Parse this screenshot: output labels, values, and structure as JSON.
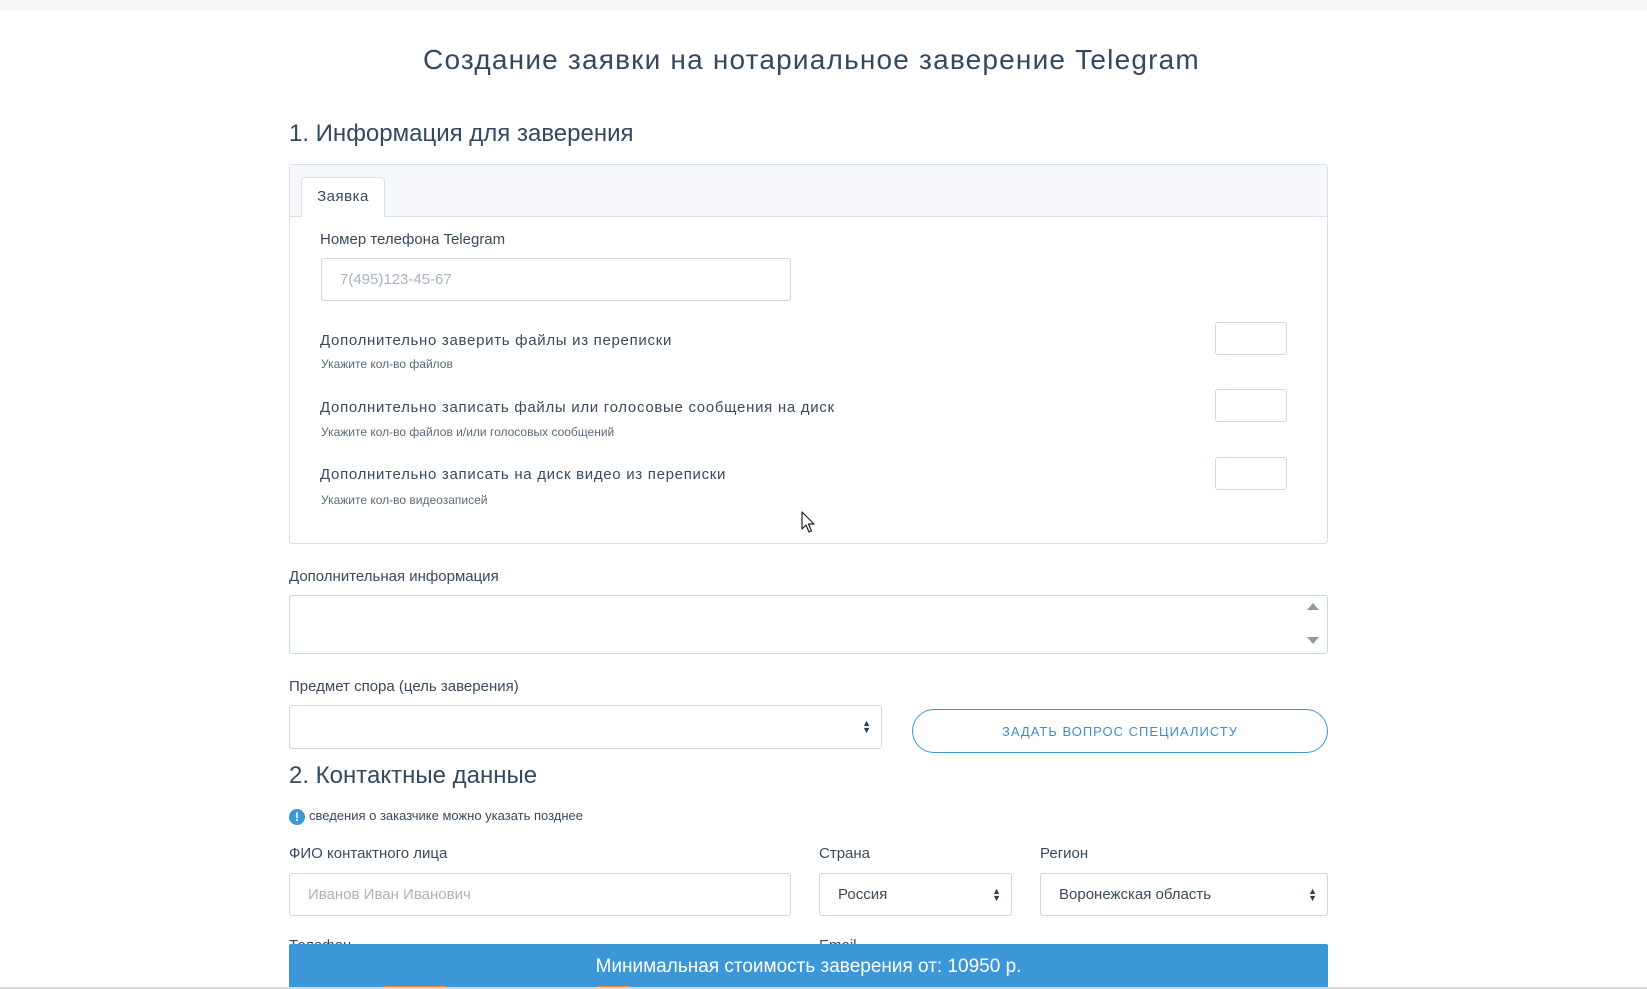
{
  "page": {
    "title": "Создание заявки на нотариальное заверение Telegram"
  },
  "section1": {
    "title": "1. Информация для заверения",
    "tab_label": "Заявка",
    "phone_label": "Номер телефона Telegram",
    "phone_placeholder": "7(495)123-45-67",
    "phone_value": "",
    "options": [
      {
        "label": "Дополнительно заверить файлы из переписки",
        "hint": "Укажите кол-во файлов",
        "value": ""
      },
      {
        "label": "Дополнительно записать файлы или голосовые сообщения на диск",
        "hint": "Укажите кол-во файлов и/или голосовых сообщений",
        "value": ""
      },
      {
        "label": "Дополнительно записать на диск видео из переписки",
        "hint": "Укажите кол-во видеозаписей",
        "value": ""
      }
    ],
    "extra_info_label": "Дополнительная информация",
    "extra_info_value": "",
    "dispute_label": "Предмет спора (цель заверения)",
    "dispute_value": "",
    "ask_button": "ЗАДАТЬ ВОПРОС СПЕЦИАЛИСТУ"
  },
  "section2": {
    "title": "2. Контактные данные",
    "note": "сведения о заказчике можно указать позднее",
    "fio_label": "ФИО контактного лица",
    "fio_placeholder": "Иванов Иван Иванович",
    "fio_value": "",
    "country_label": "Страна",
    "country_value": "Россия",
    "region_label": "Регион",
    "region_value": "Воронежская область",
    "cut_label_1": "Телефон",
    "cut_label_2": "Email"
  },
  "footer": {
    "price_text": "Минимальная стоимость заверения от: 10950 р."
  },
  "colors": {
    "accent": "#3b97d8",
    "text": "#3a4a5c",
    "border": "#c9dae6",
    "orange": "#e8873a"
  },
  "icons": {
    "info": "info-circle-icon",
    "select_arrows": "sort-arrows-icon",
    "cursor": "mouse-pointer-icon"
  }
}
